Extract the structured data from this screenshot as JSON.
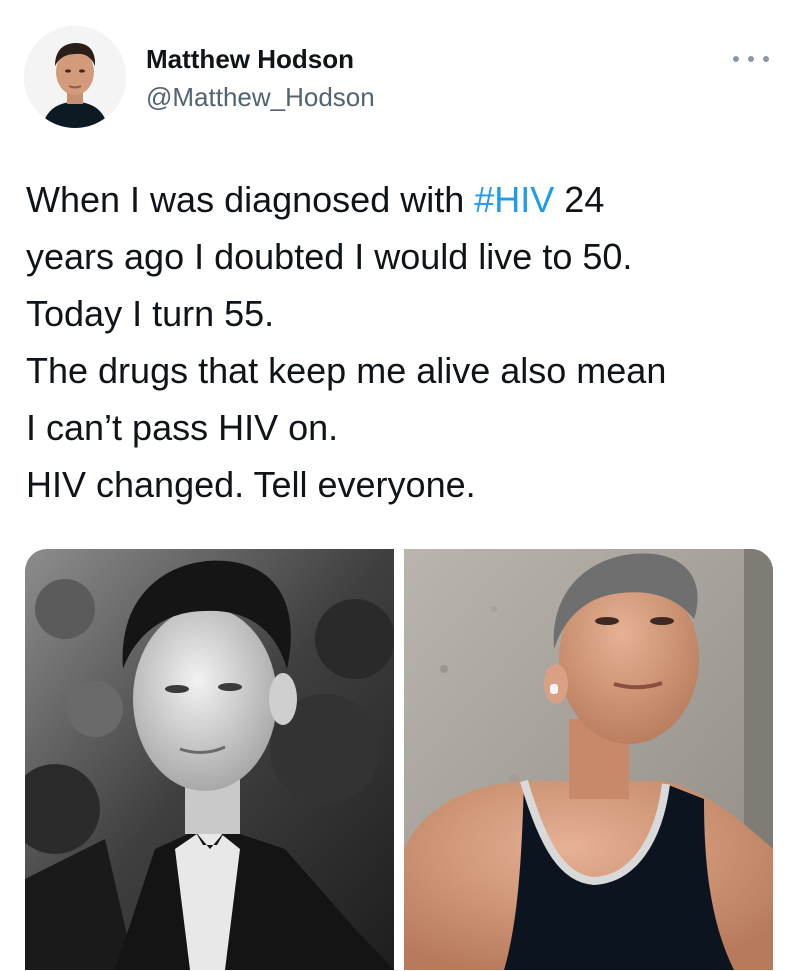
{
  "tweet": {
    "author": {
      "display_name": "Matthew Hodson",
      "handle": "@Matthew_Hodson"
    },
    "menu_icon": "more-horizontal-icon",
    "text_lines": [
      {
        "before": "When I was diagnosed with ",
        "hashtag": "#HIV",
        "after": " 24"
      },
      {
        "text": "years ago I doubted I would live to 50."
      },
      {
        "text": "Today I turn 55."
      },
      {
        "text": "The drugs that keep me alive also mean"
      },
      {
        "text": "I can’t pass HIV on."
      },
      {
        "text": "HIV changed. Tell everyone."
      }
    ],
    "media": [
      {
        "description_icon": "photo-young-man-tuxedo-bw"
      },
      {
        "description_icon": "photo-man-tank-top-concrete-wall"
      }
    ]
  },
  "colors": {
    "hashtag": "#1d9bf0",
    "text": "#0f1419",
    "secondary": "#536471"
  }
}
